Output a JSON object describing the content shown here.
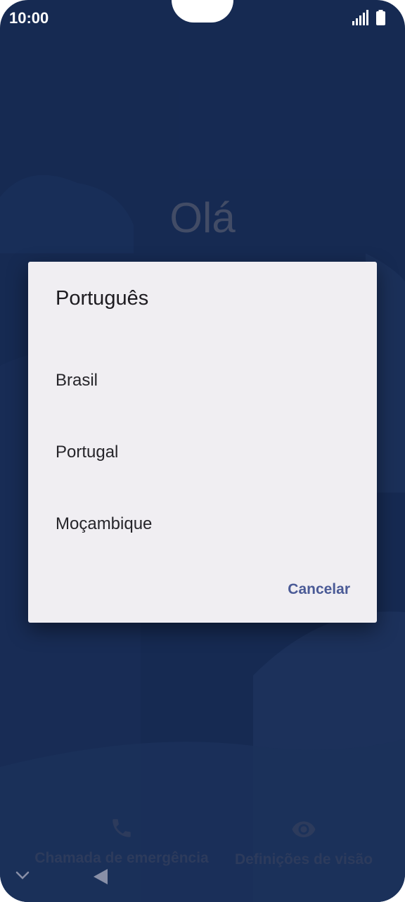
{
  "status_bar": {
    "time": "10:00",
    "icons": [
      "signal-icon",
      "battery-icon"
    ]
  },
  "greeting": "Olá",
  "dialog": {
    "title": "Português",
    "options": [
      "Brasil",
      "Portugal",
      "Moçambique"
    ],
    "cancel_label": "Cancelar"
  },
  "bottom_actions": {
    "emergency_label": "Chamada de emergência",
    "vision_label": "Definições de visão"
  },
  "navigation": {
    "icons": [
      "chevron-down-icon",
      "back-icon"
    ]
  },
  "colors": {
    "background": "#1c3563",
    "dialog_surface": "#f0eef2",
    "accent": "#4a5a96"
  }
}
